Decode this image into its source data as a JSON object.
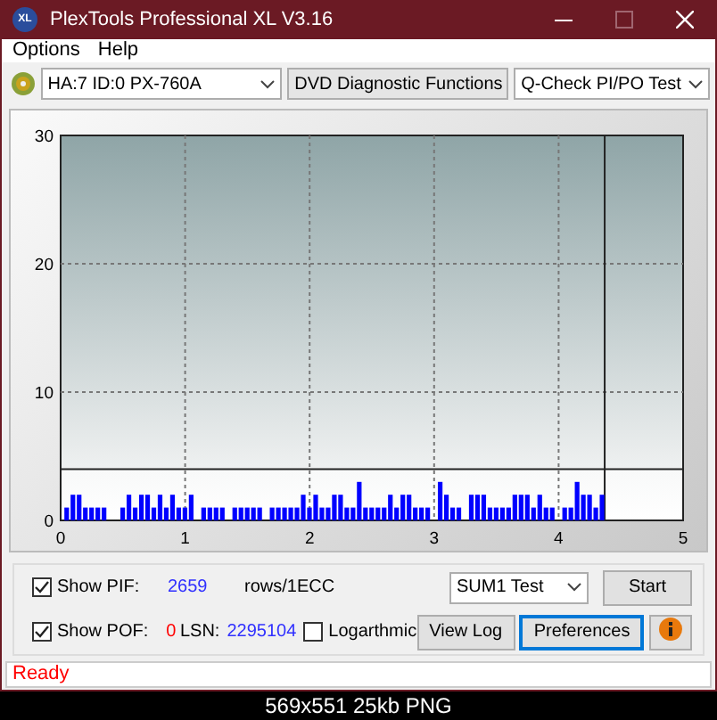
{
  "window": {
    "app_icon": "XL",
    "title": "PlexTools Professional XL V3.16"
  },
  "menu": [
    "Options",
    "Help"
  ],
  "toolbar": {
    "drive": "HA:7 ID:0  PX-760A",
    "function": "DVD Diagnostic Functions",
    "test": "Q-Check PI/PO Test"
  },
  "chart_data": {
    "type": "bar",
    "xlim": [
      0,
      5
    ],
    "ylim": [
      0,
      30
    ],
    "xticks": [
      0,
      1,
      2,
      3,
      4,
      5
    ],
    "yticks": [
      0,
      10,
      20,
      30
    ],
    "grid": true,
    "x": [
      0.05,
      0.1,
      0.15,
      0.2,
      0.25,
      0.3,
      0.35,
      0.5,
      0.55,
      0.6,
      0.65,
      0.7,
      0.75,
      0.8,
      0.85,
      0.9,
      0.95,
      1.0,
      1.05,
      1.15,
      1.2,
      1.25,
      1.3,
      1.4,
      1.45,
      1.5,
      1.55,
      1.6,
      1.7,
      1.75,
      1.8,
      1.85,
      1.9,
      1.95,
      2.0,
      2.05,
      2.1,
      2.15,
      2.2,
      2.25,
      2.3,
      2.35,
      2.4,
      2.45,
      2.5,
      2.55,
      2.6,
      2.65,
      2.7,
      2.75,
      2.8,
      2.85,
      2.9,
      2.95,
      3.05,
      3.1,
      3.15,
      3.2,
      3.3,
      3.35,
      3.4,
      3.45,
      3.5,
      3.55,
      3.6,
      3.65,
      3.7,
      3.75,
      3.8,
      3.85,
      3.9,
      3.95,
      4.05,
      4.1,
      4.15,
      4.2,
      4.25,
      4.3,
      4.35
    ],
    "series": [
      {
        "color": "#0000ff",
        "values": [
          1,
          2,
          2,
          1,
          1,
          1,
          1,
          1,
          2,
          1,
          2,
          2,
          1,
          2,
          1,
          2,
          1,
          1,
          2,
          1,
          1,
          1,
          1,
          1,
          1,
          1,
          1,
          1,
          1,
          1,
          1,
          1,
          1,
          2,
          1,
          2,
          1,
          1,
          2,
          2,
          1,
          1,
          3,
          1,
          1,
          1,
          1,
          2,
          1,
          2,
          2,
          1,
          1,
          1,
          3,
          2,
          1,
          1,
          2,
          2,
          2,
          1,
          1,
          1,
          1,
          2,
          2,
          2,
          1,
          2,
          1,
          1,
          1,
          1,
          3,
          2,
          2,
          1,
          2
        ]
      }
    ],
    "ref_lines": [
      {
        "axis": "y",
        "value": 4
      },
      {
        "axis": "x",
        "value": 4.37
      }
    ]
  },
  "controls": {
    "show_pif": {
      "label": "Show PIF:",
      "checked": true,
      "value": "2659",
      "unit": "rows/1ECC"
    },
    "show_pof": {
      "label": "Show POF:",
      "checked": true,
      "value": "0"
    },
    "lsn": {
      "label": "LSN:",
      "value": "2295104"
    },
    "logarithmic": {
      "label": "Logarthmic",
      "checked": false
    },
    "test_select": "SUM1 Test",
    "buttons": [
      {
        "kind": "text",
        "label": "Start",
        "focused": false
      },
      {
        "kind": "text",
        "label": "View Log",
        "focused": false
      },
      {
        "kind": "text",
        "label": "Preferences",
        "focused": true
      },
      {
        "kind": "info",
        "focused": false
      }
    ]
  },
  "status_bar": "Ready",
  "image_caption": "569x551 25kb PNG"
}
